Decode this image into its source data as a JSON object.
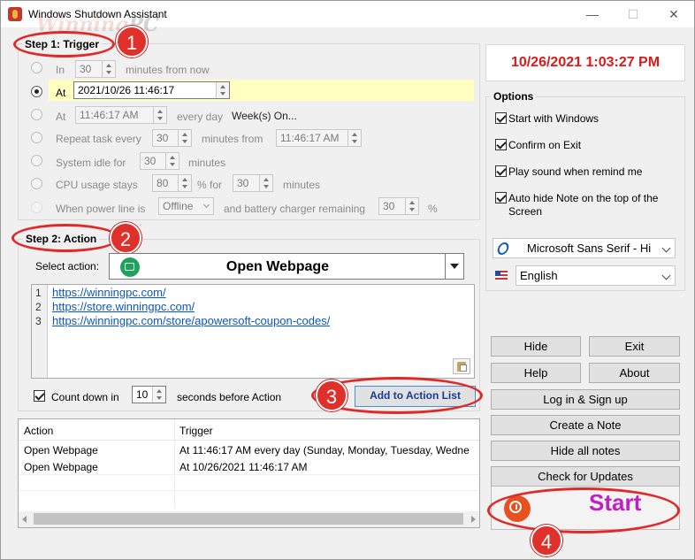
{
  "window": {
    "title": "Windows Shutdown Assistant",
    "watermark_a": "Winning",
    "watermark_b": "PC",
    "minimize": "—",
    "maximize": "☐",
    "close": "✕"
  },
  "step1": {
    "label": "Step 1: Trigger",
    "badge": "1",
    "in": {
      "label": "In",
      "value": "30",
      "suffix": "minutes from now"
    },
    "at": {
      "label": "At",
      "value": "2021/10/26   11:46:17"
    },
    "at_daily": {
      "label": "At",
      "value": "11:46:17 AM",
      "suffix": "every day",
      "days": "Week(s) On..."
    },
    "repeat": {
      "label": "Repeat task every",
      "value": "30",
      "mid": "minutes from",
      "time": "11:46:17 AM"
    },
    "idle": {
      "label": "System idle for",
      "value": "30",
      "suffix": "minutes"
    },
    "cpu": {
      "label": "CPU usage stays",
      "value": "80",
      "mid": "% for",
      "value2": "30",
      "suffix": "minutes"
    },
    "power": {
      "label": "When power line is",
      "select": "Offline",
      "mid": "and battery charger remaining",
      "value": "30",
      "suffix": "%"
    }
  },
  "step2": {
    "label": "Step 2: Action",
    "badge": "2",
    "select_label": "Select action:",
    "action": "Open Webpage",
    "lines": [
      {
        "n": "1",
        "url": "https://winningpc.com/"
      },
      {
        "n": "2",
        "url": "https://store.winningpc.com/"
      },
      {
        "n": "3",
        "url": "https://winningpc.com/store/apowersoft-coupon-codes/"
      }
    ],
    "countdown_label": "Count down in",
    "countdown_value": "10",
    "countdown_suffix": "seconds before Action",
    "add_button": "Add to Action List",
    "badge3": "3"
  },
  "list": {
    "headers": [
      "Action",
      "Trigger"
    ],
    "rows": [
      [
        "Open Webpage",
        "At 11:46:17 AM every day (Sunday,  Monday,  Tuesday,  Wedne"
      ],
      [
        "Open Webpage",
        "At 10/26/2021 11:46:17 AM"
      ]
    ]
  },
  "clock": "10/26/2021 1:03:27 PM",
  "options": {
    "label": "Options",
    "items": [
      "Start with Windows",
      "Confirm on Exit",
      "Play sound when remind me",
      "Auto hide Note on the top of the Screen"
    ],
    "font": "Microsoft Sans Serif   - Hi",
    "language": "English"
  },
  "buttons": {
    "hide": "Hide",
    "exit": "Exit",
    "help": "Help",
    "about": "About",
    "login": "Log in & Sign up",
    "note": "Create a Note",
    "hide_notes": "Hide all notes",
    "updates": "Check for Updates",
    "start": "Start",
    "badge4": "4"
  },
  "colors": {
    "clock_red": "#e01818",
    "start_magenta": "#c020c0",
    "annotation_red": "#e0302a",
    "link_blue": "#0b57c0"
  }
}
